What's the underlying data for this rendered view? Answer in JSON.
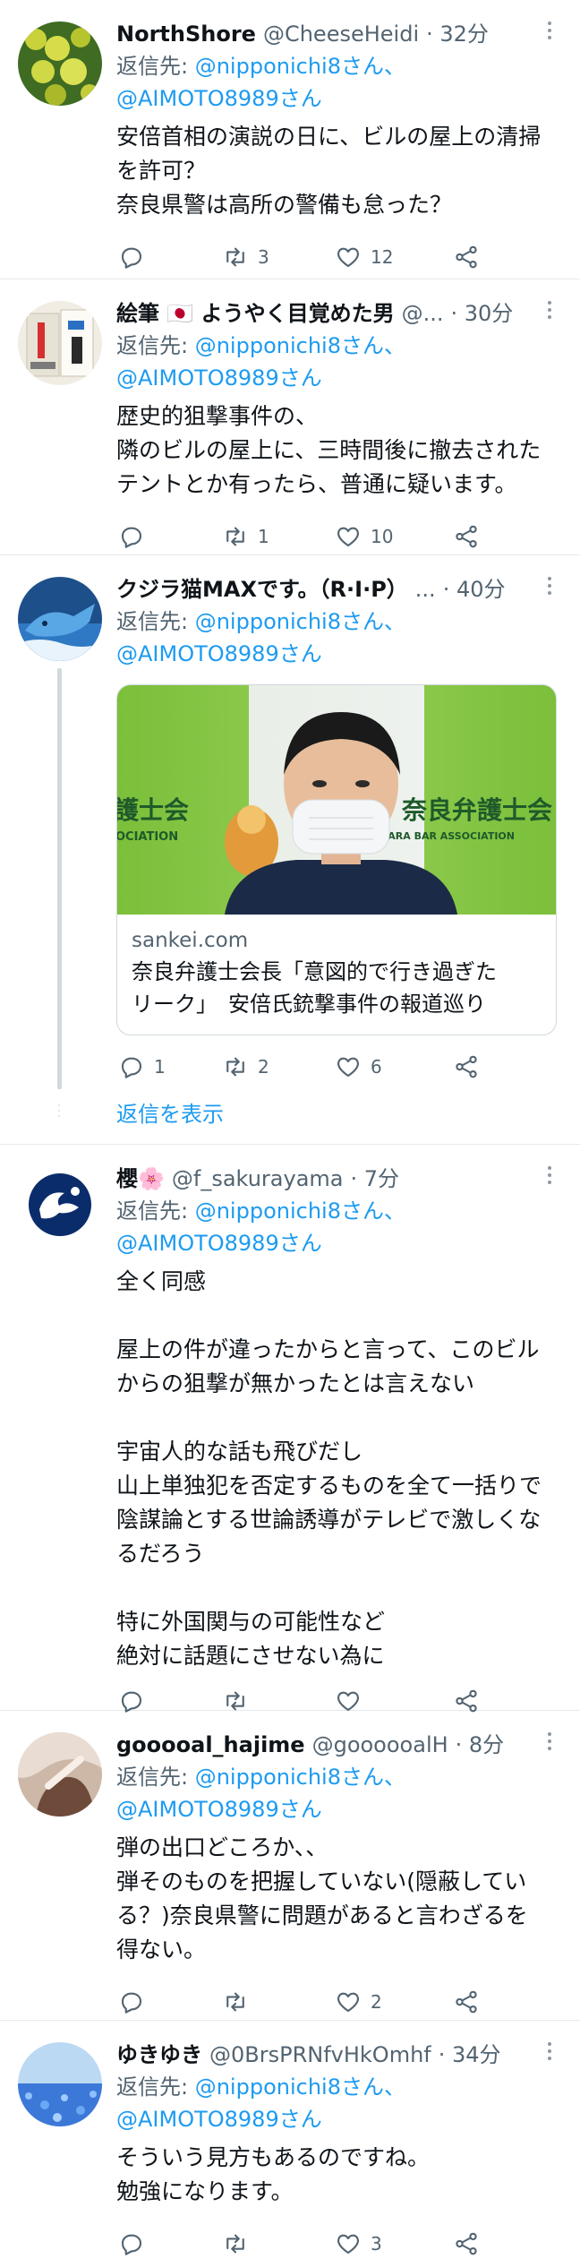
{
  "tweets": [
    {
      "name": "NorthShore",
      "handle": "@CheeseHeidi",
      "time": "· 32分",
      "replying_prefix": "返信先: ",
      "reply_to_1": "@nipponichi8さん、",
      "reply_to_2": "@AIMOTO8989さん",
      "text": "安倍首相の演説の日に、ビルの屋上の清掃\nを許可？\n奈良県警は高所の警備も怠った？",
      "replies": "",
      "retweets": "3",
      "likes": "12"
    },
    {
      "name": "絵筆 🇯🇵 ようやく目覚めた男",
      "handle": "@...",
      "time": "· 30分",
      "replying_prefix": "返信先: ",
      "reply_to_1": "@nipponichi8さん、",
      "reply_to_2": "@AIMOTO8989さん",
      "text": "歴史的狙撃事件の、\n隣のビルの屋上に、三時間後に撤去された\nテントとか有ったら、普通に疑います。",
      "replies": "",
      "retweets": "1",
      "likes": "10"
    },
    {
      "name": "クジラ猫MAXです。（R·I·P）",
      "handle": "...",
      "time": "· 40分",
      "replying_prefix": "返信先: ",
      "reply_to_1": "@nipponichi8さん、",
      "reply_to_2": "@AIMOTO8989さん",
      "card": {
        "image_text_left": "護士会",
        "image_text_left_sub": "OCIATION",
        "image_text_right": "奈良弁護士会",
        "image_text_right_sub": "NARA BAR ASSOCIATION",
        "domain": "sankei.com",
        "title": "奈良弁護士会長「意図的で行き過ぎた\nリーク」　安倍氏銃撃事件の報道巡り"
      },
      "replies": "1",
      "retweets": "2",
      "likes": "6",
      "show_replies": "返信を表示"
    },
    {
      "name": "櫻🌸",
      "handle": "@f_sakurayama",
      "time": "· 7分",
      "replying_prefix": "返信先: ",
      "reply_to_1": "@nipponichi8さん、",
      "reply_to_2": "@AIMOTO8989さん",
      "text": "全く同感\n\n屋上の件が違ったからと言って、このビル\nからの狙撃が無かったとは言えない\n\n宇宙人的な話も飛びだし\n山上単独犯を否定するものを全て一括りで\n陰謀論とする世論誘導がテレビで激しくな\nるだろう\n\n特に外国関与の可能性など\n絶対に話題にさせない為に",
      "replies": "",
      "retweets": "",
      "likes": ""
    },
    {
      "name": "gooooal_hajime",
      "handle": "@goooooalH",
      "time": "· 8分",
      "replying_prefix": "返信先: ",
      "reply_to_1": "@nipponichi8さん、",
      "reply_to_2": "@AIMOTO8989さん",
      "text": "弾の出口どころか、、\n弾そのものを把握していない(隠蔽してい\nる？)奈良県警に問題があると言わざるを\n得ない。",
      "replies": "",
      "retweets": "",
      "likes": "2"
    },
    {
      "name": "ゆきゆき",
      "handle": "@0BrsPRNfvHkOmhf",
      "time": "· 34分",
      "replying_prefix": "返信先: ",
      "reply_to_1": "@nipponichi8さん、",
      "reply_to_2": "@AIMOTO8989さん",
      "text": "そういう見方もあるのですね。\n勉強になります。",
      "replies": "",
      "retweets": "",
      "likes": "3"
    }
  ],
  "icons": {
    "reply": "reply-icon",
    "retweet": "retweet-icon",
    "like": "heart-icon",
    "share": "share-icon",
    "more": "more-icon"
  },
  "colors": {
    "link": "#1d9bf0",
    "secondary_text": "#536471",
    "divider": "#e6e9ec",
    "thread_line": "#cfd9de"
  }
}
